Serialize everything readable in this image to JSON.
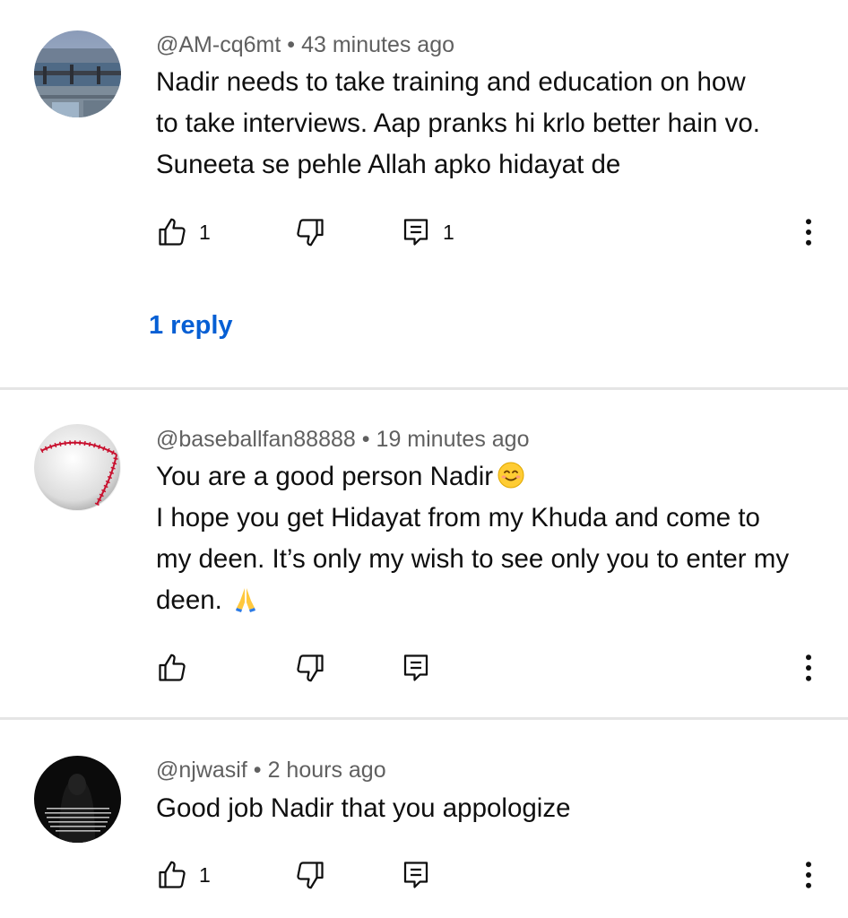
{
  "comments": [
    {
      "handle": "@AM-cq6mt",
      "time": "43 minutes ago",
      "lines": [
        "Nadir needs to take training and education on how",
        "to take interviews. Aap pranks hi krlo better hain vo.",
        "Suneeta se pehle Allah apko hidayat de"
      ],
      "likes": "1",
      "replies_count": "1",
      "reply_link": "1 reply",
      "avatar_icon": "city-bridge-photo-avatar"
    },
    {
      "handle": "@baseballfan88888",
      "time": "19 minutes ago",
      "lines": [
        "You are a good person Nadir",
        "I hope you get Hidayat from my Khuda and come to",
        "my deen. It’s only my wish to see only you to enter my",
        "deen."
      ],
      "emoji_1": "smiling-face-emoji",
      "emoji_2": "folded-hands-emoji",
      "avatar_icon": "baseball-avatar"
    },
    {
      "handle": "@njwasif",
      "time": "2 hours ago",
      "lines": [
        "Good job Nadir that you appologize"
      ],
      "likes": "1",
      "avatar_icon": "dark-text-avatar"
    }
  ],
  "separator": "•",
  "colors": {
    "text": "#0f0f0f",
    "meta": "#606060",
    "link": "#065fd4",
    "divider": "#e5e5e5"
  },
  "icons": [
    "like-icon",
    "dislike-icon",
    "reply-icon",
    "more-options-icon"
  ]
}
